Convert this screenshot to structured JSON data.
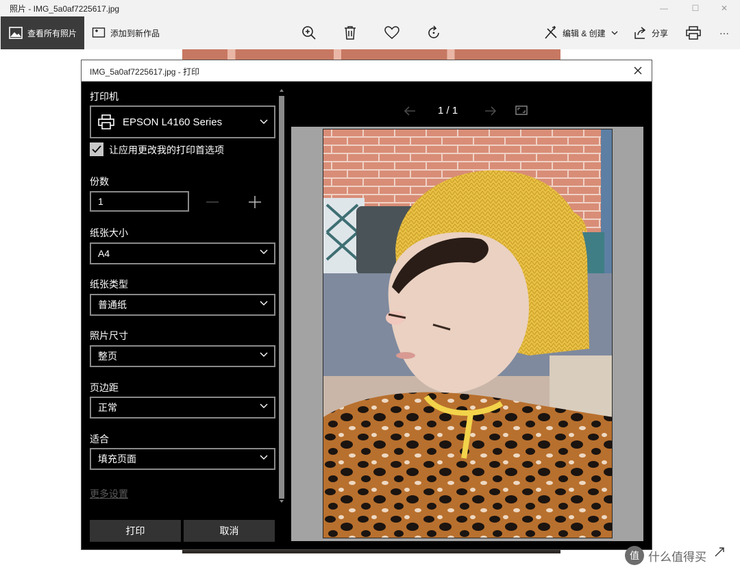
{
  "window": {
    "title": "照片 - IMG_5a0af7225617.jpg",
    "minimize": "—",
    "maximize": "☐",
    "close": "✕"
  },
  "appbar": {
    "all_photos": "查看所有照片",
    "add_to_creation": "添加到新作品",
    "edit_create": "编辑 & 创建",
    "share": "分享",
    "more": "···"
  },
  "dialog": {
    "title": "IMG_5a0af7225617.jpg - 打印",
    "printer_label": "打印机",
    "printer_value": "EPSON L4160 Series",
    "app_pref_label": "让应用更改我的打印首选项",
    "app_pref_checked": true,
    "copies_label": "份数",
    "copies_value": "1",
    "paper_size_label": "纸张大小",
    "paper_size_value": "A4",
    "paper_type_label": "纸张类型",
    "paper_type_value": "普通纸",
    "photo_size_label": "照片尺寸",
    "photo_size_value": "整页",
    "margins_label": "页边距",
    "margins_value": "正常",
    "fit_label": "适合",
    "fit_value": "填充页面",
    "more_settings": "更多设置",
    "print_button": "打印",
    "cancel_button": "取消",
    "page_indicator": "1 / 1"
  },
  "watermark": {
    "logo": "值",
    "text": "什么值得买"
  },
  "colors": {
    "dialog_bg": "#000000",
    "field_border": "#8a8a8a",
    "button_bg": "#333333",
    "active_tab": "#3b3b3b",
    "preview_bg": "#a3a3a3"
  }
}
